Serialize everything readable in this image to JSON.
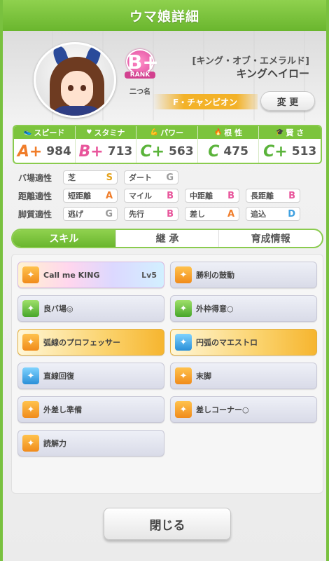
{
  "dialog": {
    "title": "ウマ娘詳細",
    "close_label": "閉じる"
  },
  "character": {
    "epithet": "[キング・オブ・エメラルド]",
    "name": "キングヘイロー",
    "rank_letter": "B+",
    "rank_word": "RANK",
    "nickname": "二つ名",
    "title": "F・チャンピオン",
    "change_label": "変 更"
  },
  "stats": [
    {
      "label": "スピード",
      "icon": "shoe-icon",
      "grade": "A+",
      "grade_color": "#f07d2a",
      "value": "984"
    },
    {
      "label": "スタミナ",
      "icon": "heart-icon",
      "grade": "B+",
      "grade_color": "#e8559b",
      "value": "713"
    },
    {
      "label": "パワー",
      "icon": "muscle-icon",
      "grade": "C+",
      "grade_color": "#5ab33a",
      "value": "563"
    },
    {
      "label": "根 性",
      "icon": "flame-icon",
      "grade": "C",
      "grade_color": "#5ab33a",
      "value": "475"
    },
    {
      "label": "賢 さ",
      "icon": "graduation-cap-icon",
      "grade": "C+",
      "grade_color": "#5ab33a",
      "value": "513"
    }
  ],
  "aptitudes": [
    {
      "label": "バ場適性",
      "cells": [
        {
          "name": "芝",
          "grade": "S",
          "color": "#e4a21a"
        },
        {
          "name": "ダート",
          "grade": "G",
          "color": "#9a9a9a"
        }
      ]
    },
    {
      "label": "距離適性",
      "cells": [
        {
          "name": "短距離",
          "grade": "A",
          "color": "#f07d2a"
        },
        {
          "name": "マイル",
          "grade": "B",
          "color": "#e8559b"
        },
        {
          "name": "中距離",
          "grade": "B",
          "color": "#e8559b"
        },
        {
          "name": "長距離",
          "grade": "B",
          "color": "#e8559b"
        }
      ]
    },
    {
      "label": "脚質適性",
      "cells": [
        {
          "name": "逃げ",
          "grade": "G",
          "color": "#9a9a9a"
        },
        {
          "name": "先行",
          "grade": "B",
          "color": "#e8559b"
        },
        {
          "name": "差し",
          "grade": "A",
          "color": "#f07d2a"
        },
        {
          "name": "追込",
          "grade": "D",
          "color": "#3fa0e0"
        }
      ]
    }
  ],
  "tabs": [
    "スキル",
    "継 承",
    "育成情報"
  ],
  "skills": [
    {
      "name": "Call me KING",
      "level": "Lv5",
      "style": "rainbow",
      "icon": "ic-orange"
    },
    {
      "name": "勝利の鼓動",
      "level": "",
      "style": "",
      "icon": "ic-orange"
    },
    {
      "name": "良バ場◎",
      "level": "",
      "style": "",
      "icon": "ic-green"
    },
    {
      "name": "外枠得意○",
      "level": "",
      "style": "",
      "icon": "ic-green"
    },
    {
      "name": "弧線のプロフェッサー",
      "level": "",
      "style": "gold",
      "icon": "ic-orange"
    },
    {
      "name": "円弧のマエストロ",
      "level": "",
      "style": "gold",
      "icon": "ic-blue"
    },
    {
      "name": "直線回復",
      "level": "",
      "style": "",
      "icon": "ic-blue"
    },
    {
      "name": "末脚",
      "level": "",
      "style": "",
      "icon": "ic-orange"
    },
    {
      "name": "外差し準備",
      "level": "",
      "style": "",
      "icon": "ic-orange"
    },
    {
      "name": "差しコーナー○",
      "level": "",
      "style": "",
      "icon": "ic-orange"
    },
    {
      "name": "読解力",
      "level": "",
      "style": "",
      "icon": "ic-orange"
    }
  ]
}
